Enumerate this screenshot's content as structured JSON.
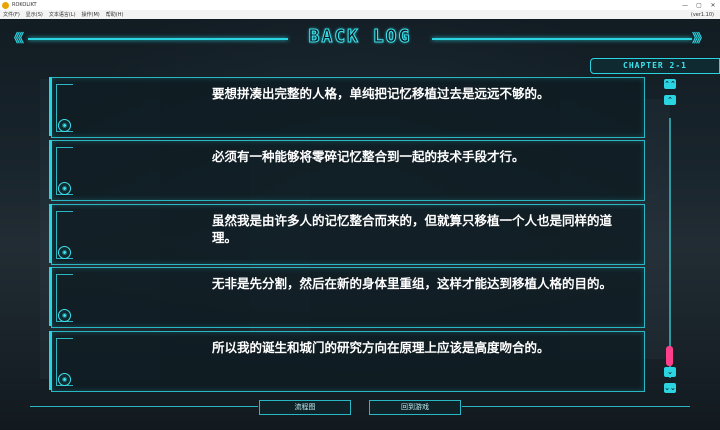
{
  "window": {
    "title": "ROKOLIKT",
    "minimize": "—",
    "maximize": "▢",
    "close": "✕"
  },
  "menubar": {
    "items": [
      "文件(F)",
      "显示(S)",
      "文本语言(L)",
      "操作(M)",
      "帮助(H)"
    ],
    "version": "(ver1.10)"
  },
  "backlog": {
    "title": "BACK LOG",
    "chapter": "CHAPTER 2-1",
    "entries": [
      "要想拼凑出完整的人格，单纯把记忆移植过去是远远不够的。",
      "必须有一种能够将零碎记忆整合到一起的技术手段才行。",
      "虽然我是由许多人的记忆整合而来的，但就算只移植一个人也是同样的道理。",
      "无非是先分割，然后在新的身体里重组，这样才能达到移植人格的目的。",
      "所以我的诞生和城门的研究方向在原理上应该是高度吻合的。"
    ]
  },
  "scroll": {
    "top_symbol": "⌃⌃",
    "up_symbol": "⌃",
    "down_symbol": "⌄",
    "bottom_symbol": "⌄⌄",
    "position_fraction": 0.95
  },
  "buttons": {
    "flowchart": "流程图",
    "return_game": "回到游戏"
  },
  "colors": {
    "accent": "#2ad4e0",
    "scroll_thumb": "#ff3f8c",
    "panel_bg": "#0e1c22"
  }
}
